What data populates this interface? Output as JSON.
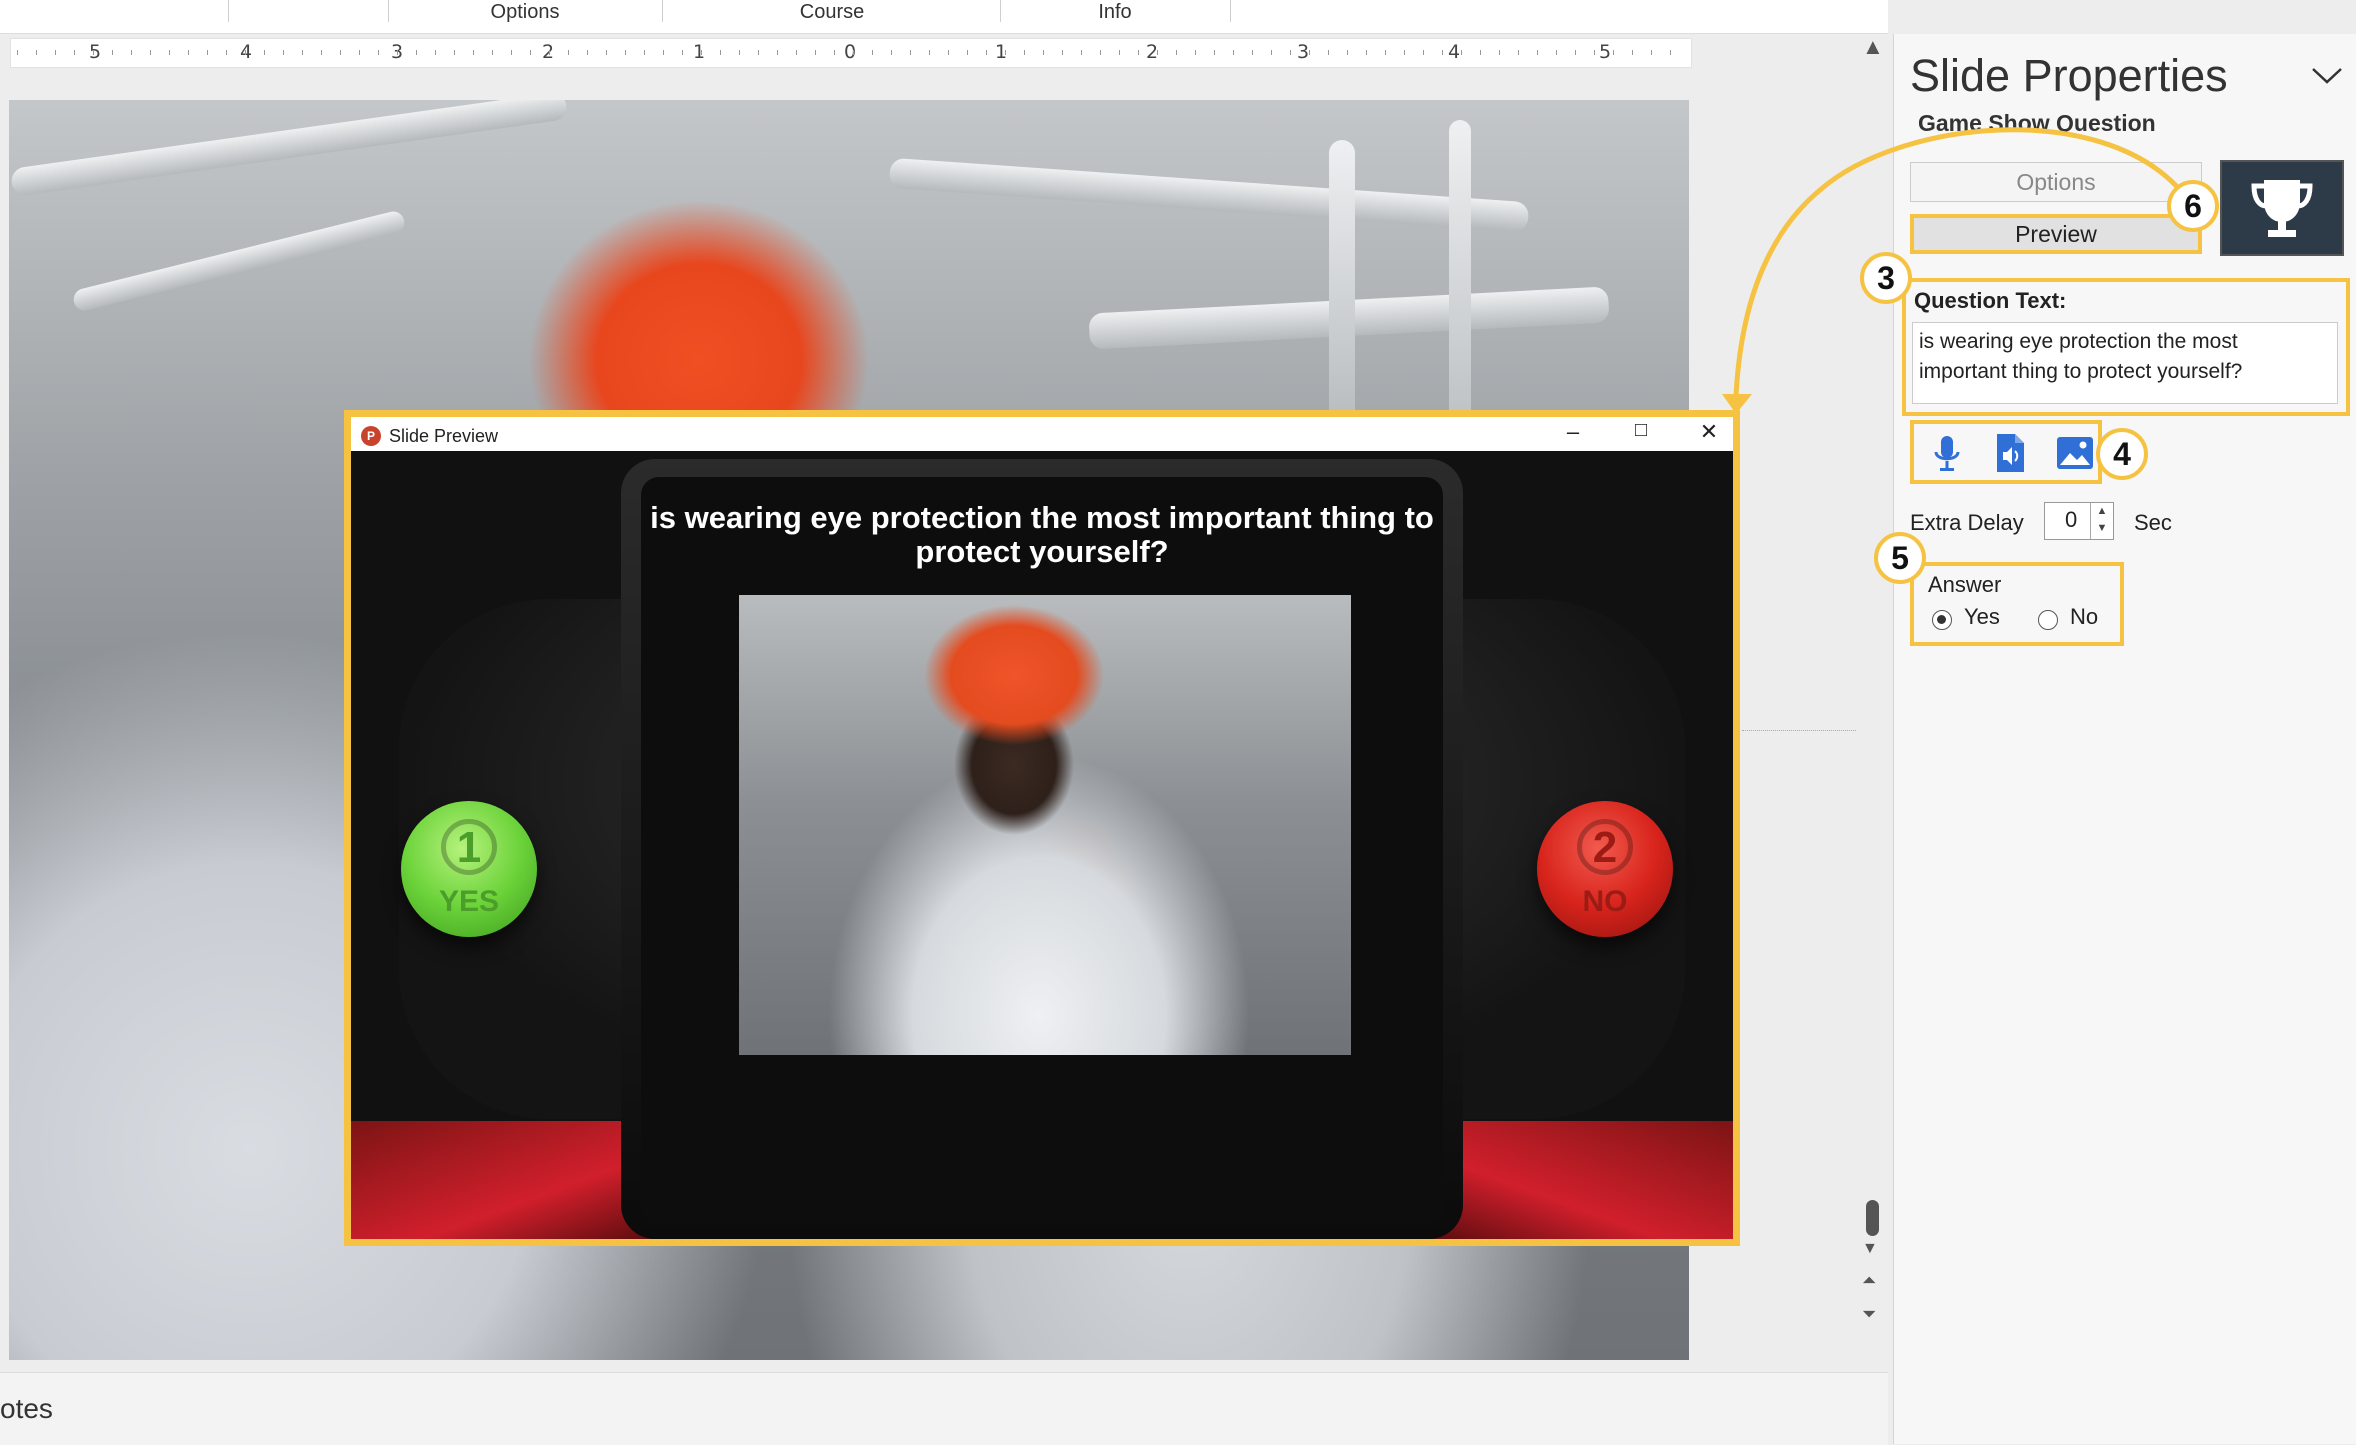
{
  "ribbon": {
    "tabs": [
      "Options",
      "Course",
      "Info"
    ]
  },
  "ruler": {
    "labels": [
      "5",
      "4",
      "3",
      "2",
      "1",
      "0",
      "1",
      "2",
      "3",
      "4",
      "5"
    ]
  },
  "notes": {
    "label": "otes"
  },
  "panel": {
    "title": "Slide Properties",
    "subtitle": "Game Show Question",
    "options_label": "Options",
    "preview_label": "Preview",
    "question_label": "Question Text:",
    "question_value": "is wearing eye protection the most important thing to protect yourself?",
    "extra_delay_label": "Extra Delay",
    "extra_delay_value": "0",
    "extra_delay_unit": "Sec",
    "answer_label": "Answer",
    "answer_options": [
      "Yes",
      "No"
    ],
    "answer_selected": "Yes"
  },
  "callouts": {
    "c3": "3",
    "c4": "4",
    "c5": "5",
    "c6": "6"
  },
  "preview": {
    "window_title": "Slide Preview",
    "question": "is wearing eye protection the most important thing to protect yourself?",
    "yes_number": "1",
    "yes_label": "YES",
    "no_number": "2",
    "no_label": "NO"
  },
  "icons": {
    "app": "powerpoint-icon",
    "media": [
      "microphone-icon",
      "audio-file-icon",
      "image-icon"
    ],
    "trophy": "trophy-icon"
  },
  "colors": {
    "highlight": "#f5c242",
    "trophy_bg": "#2d3a48",
    "media_icon": "#2f6fd6"
  }
}
